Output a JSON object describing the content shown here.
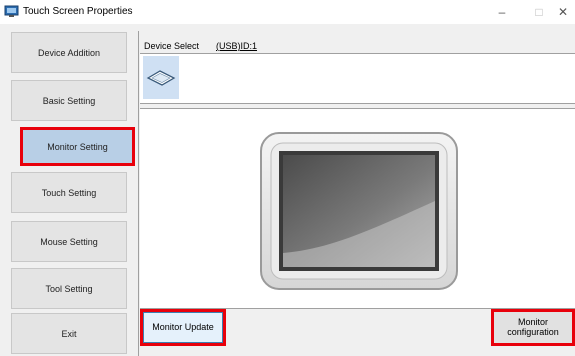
{
  "window": {
    "title": "Touch Screen Properties",
    "controls": {
      "minimize": "–",
      "maximize": "□",
      "close": "✕"
    }
  },
  "nav": {
    "items": [
      {
        "id": "device-addition",
        "label": "Device Addition",
        "active": false
      },
      {
        "id": "basic-setting",
        "label": "Basic Setting",
        "active": false
      },
      {
        "id": "monitor-setting",
        "label": "Monitor Setting",
        "active": true
      },
      {
        "id": "touch-setting",
        "label": "Touch Setting",
        "active": false
      },
      {
        "id": "mouse-setting",
        "label": "Mouse Setting",
        "active": false
      },
      {
        "id": "tool-setting",
        "label": "Tool Setting",
        "active": false
      },
      {
        "id": "exit",
        "label": "Exit",
        "active": false
      }
    ]
  },
  "device_select": {
    "label": "Device Select",
    "value": "(USB)ID:1",
    "device_icon": "monitor-flat-icon"
  },
  "actions": {
    "monitor_update": "Monitor Update",
    "monitor_configuration_line1": "Monitor",
    "monitor_configuration_line2": "configuration"
  },
  "colors": {
    "highlight": "#e8000b",
    "active_nav": "#b8cfe6",
    "device_tile": "#cfe0f3"
  }
}
